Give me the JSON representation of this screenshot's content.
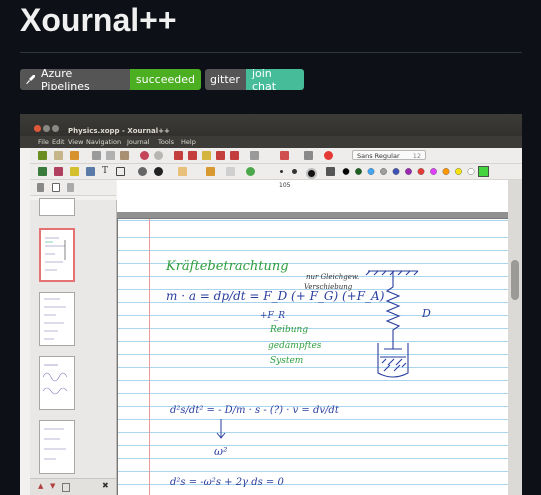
{
  "readme": {
    "title": "Xournal++",
    "badges": [
      {
        "left": "Azure Pipelines",
        "right": "succeeded",
        "icon": "azure-pipelines-icon"
      },
      {
        "left": "gitter",
        "right": "join chat"
      }
    ]
  },
  "app": {
    "window_title": "Physics.xopp - Xournal++",
    "menus": [
      "File",
      "Edit",
      "View",
      "Navigation",
      "Journal",
      "Tools",
      "Help"
    ],
    "font_select": {
      "family": "Sans Regular",
      "size": "12"
    },
    "page_number": "105",
    "colors": [
      "#000000",
      "#1b5e20",
      "#42a5f5",
      "#9e9e9e",
      "#3f51b5",
      "#9c27b0",
      "#e53935",
      "#e040fb",
      "#ff9800",
      "#f4e40c",
      "#ffffff",
      "#43d43f"
    ],
    "active_color": "#43d43f",
    "record_color": "#e53935"
  },
  "notes": {
    "heading": "Kräftebetrachtung",
    "eq1": "m · a = dp/dt = F_D (+ F_G) (+F_A)",
    "side_note_1": "nur Gleichgew.",
    "side_note_2": "Verschiebung",
    "fr_term": "+F_R",
    "friction_1": "Reibung",
    "friction_2": "gedämpftes",
    "friction_3": "System",
    "spring_label": "D",
    "eq2": "d²s/dt² = - D/m · s - (?) · v = dv/dt",
    "omega": "ω²",
    "eq3": "d²s = -ω²s + 2γ ds = 0"
  }
}
